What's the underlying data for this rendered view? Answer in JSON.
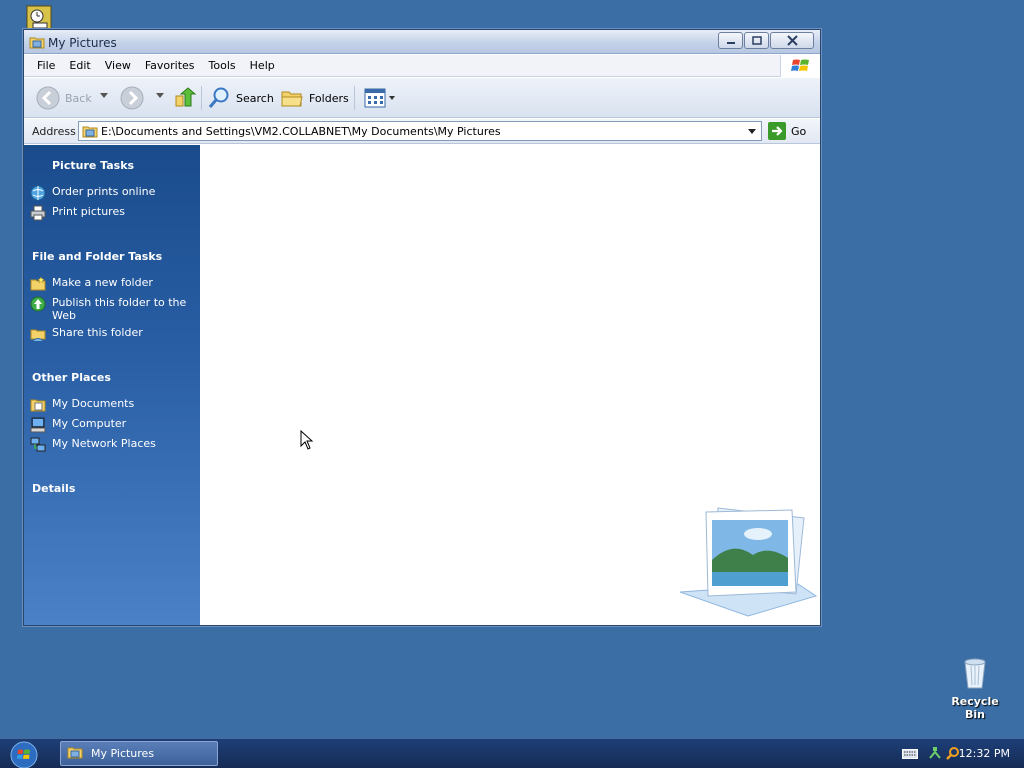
{
  "window": {
    "title": "My Pictures",
    "menu": [
      "File",
      "Edit",
      "View",
      "Favorites",
      "Tools",
      "Help"
    ],
    "toolbar": {
      "back_label": "Back",
      "search_label": "Search",
      "folders_label": "Folders"
    },
    "address": {
      "label": "Address",
      "value": "E:\\Documents and Settings\\VM2.COLLABNET\\My Documents\\My Pictures",
      "go_label": "Go"
    },
    "taskpane": {
      "picture_tasks": {
        "heading": "Picture Tasks",
        "items": [
          "Order prints online",
          "Print pictures"
        ]
      },
      "file_folder_tasks": {
        "heading": "File and Folder Tasks",
        "items": [
          "Make a new folder",
          "Publish this folder to the Web",
          "Share this folder"
        ]
      },
      "other_places": {
        "heading": "Other Places",
        "items": [
          "My Documents",
          "My Computer",
          "My Network Places"
        ]
      },
      "details": {
        "heading": "Details"
      }
    }
  },
  "desktop": {
    "recycle_bin_label": "Recycle Bin"
  },
  "taskbar": {
    "task_label": "My Pictures",
    "clock": "12:32 PM"
  },
  "colors": {
    "desktop": "#3a6ea5",
    "taskpane_top": "#1a4c8c",
    "taskpane_bottom": "#4b82c7",
    "taskbar": "#1a3566"
  }
}
